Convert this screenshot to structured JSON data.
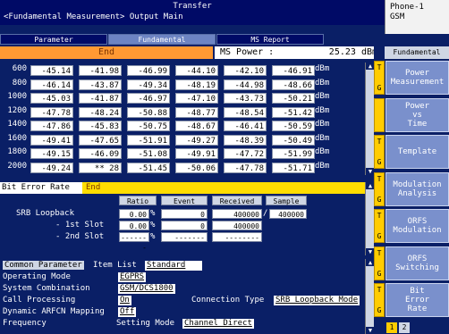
{
  "title": {
    "main": "Transfer",
    "subtitle": "<Fundamental Measurement> Output Main"
  },
  "phone": {
    "line1": "Phone-1",
    "line2": "GSM"
  },
  "tabs": [
    {
      "label": "Parameter",
      "active": false
    },
    {
      "label": "Fundamental",
      "active": true
    },
    {
      "label": "MS Report",
      "active": false
    }
  ],
  "status": {
    "state": "End",
    "ms_power_label": "MS Power :",
    "ms_power_value": "25.23",
    "ms_power_unit": "dBm"
  },
  "table": {
    "unit": "dBm",
    "rows": [
      {
        "key": "600",
        "vals": [
          "-45.14",
          "-41.98",
          "-46.99",
          "-44.10",
          "-42.10",
          "-46.91"
        ]
      },
      {
        "key": "800",
        "vals": [
          "-46.14",
          "-43.87",
          "-49.34",
          "-48.19",
          "-44.98",
          "-48.66"
        ]
      },
      {
        "key": "1000",
        "vals": [
          "-45.03",
          "-41.87",
          "-46.97",
          "-47.10",
          "-43.73",
          "-50.21"
        ]
      },
      {
        "key": "1200",
        "vals": [
          "-47.78",
          "-48.24",
          "-50.88",
          "-48.77",
          "-48.54",
          "-51.42"
        ]
      },
      {
        "key": "1400",
        "vals": [
          "-47.86",
          "-45.83",
          "-50.75",
          "-48.67",
          "-46.41",
          "-50.59"
        ]
      },
      {
        "key": "1600",
        "vals": [
          "-49.41",
          "-47.65",
          "-51.91",
          "-49.27",
          "-48.39",
          "-50.49"
        ]
      },
      {
        "key": "1800",
        "vals": [
          "-49.15",
          "-46.09",
          "-51.08",
          "-49.91",
          "-47.72",
          "-51.99"
        ]
      },
      {
        "key": "2000",
        "vals": [
          "-49.24",
          "** 28",
          "-51.45",
          "-50.06",
          "-47.78",
          "-51.71"
        ]
      }
    ]
  },
  "ber": {
    "label": "Bit Error Rate",
    "state": "End",
    "headers": {
      "ratio": "Ratio",
      "event": "Event",
      "received": "Received",
      "sample": "Sample"
    },
    "rows": [
      {
        "label": "SRB Loopback",
        "ratio": "0.00",
        "ratio_unit": "%",
        "event": "0",
        "received": "400000",
        "sep": "/",
        "sample": "400000"
      },
      {
        "label": "- 1st Slot",
        "ratio": "0.00",
        "ratio_unit": "%",
        "event": "0",
        "received": "400000",
        "sep": "",
        "sample": ""
      },
      {
        "label": "- 2nd Slot",
        "ratio": "-------",
        "ratio_unit": "%",
        "event": "-------",
        "received": "--------",
        "sep": "",
        "sample": ""
      }
    ]
  },
  "common": {
    "header_label": "Common Parameter",
    "item_list_label": "Item List",
    "item_list_value": "Standard",
    "operating_mode_label": "Operating Mode",
    "operating_mode_value": "EGPRS",
    "system_combination_label": "System Combination",
    "system_combination_value": "GSM/DCS1800",
    "call_processing_label": "Call Processing",
    "call_processing_value": "On",
    "connection_type_label": "Connection Type",
    "connection_type_value": "SRB Loopback Mode",
    "dynamic_arfcn_label": "Dynamic ARFCN Mapping",
    "dynamic_arfcn_value": "Off",
    "frequency_label": "Frequency",
    "setting_mode_label": "Setting Mode",
    "setting_mode_value": "Channel Direct"
  },
  "menu": {
    "header": "Fundamental",
    "items": [
      {
        "label": "Power\nMeasurement",
        "key_top": "T",
        "key_bottom": "G"
      },
      {
        "label": "Power\nvs\nTime",
        "key_top": "",
        "key_bottom": ""
      },
      {
        "label": "Template",
        "key_top": "T",
        "key_bottom": "G"
      },
      {
        "label": "Modulation\nAnalysis",
        "key_top": "T",
        "key_bottom": "G"
      },
      {
        "label": "ORFS\nModulation",
        "key_top": "T",
        "key_bottom": "G"
      },
      {
        "label": "ORFS\nSwitching",
        "key_top": "T",
        "key_bottom": "G"
      },
      {
        "label": "Bit\nError\nRate",
        "key_top": "T",
        "key_bottom": "G"
      }
    ],
    "pages": [
      "1",
      "2"
    ]
  }
}
